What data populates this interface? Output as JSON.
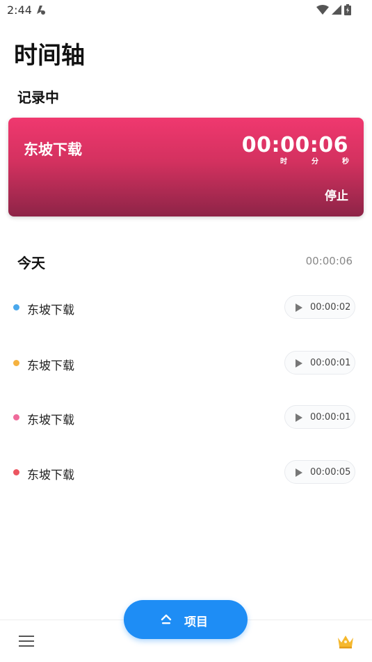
{
  "status_bar": {
    "time": "2:44"
  },
  "header": {
    "title": "时间轴"
  },
  "recording": {
    "section_label": "记录中",
    "project_name": "东坡下载",
    "timer": "00:00:06",
    "unit_hours": "时",
    "unit_minutes": "分",
    "unit_seconds": "秒",
    "stop_label": "停止",
    "gradient_top": "#f0386f",
    "gradient_bottom": "#8d2447"
  },
  "today": {
    "label": "今天",
    "total": "00:00:06",
    "entries": [
      {
        "name": "东坡下载",
        "duration": "00:00:02",
        "color": "#4aa8ec"
      },
      {
        "name": "东坡下载",
        "duration": "00:00:01",
        "color": "#f5b240"
      },
      {
        "name": "东坡下载",
        "duration": "00:00:01",
        "color": "#ef6b9b"
      },
      {
        "name": "东坡下载",
        "duration": "00:00:05",
        "color": "#ec5560"
      }
    ]
  },
  "bottom_bar": {
    "projects_label": "项目",
    "projects_color": "#1e8df5",
    "menu_icon": "hamburger-menu-icon",
    "premium_icon": "crown-icon"
  }
}
